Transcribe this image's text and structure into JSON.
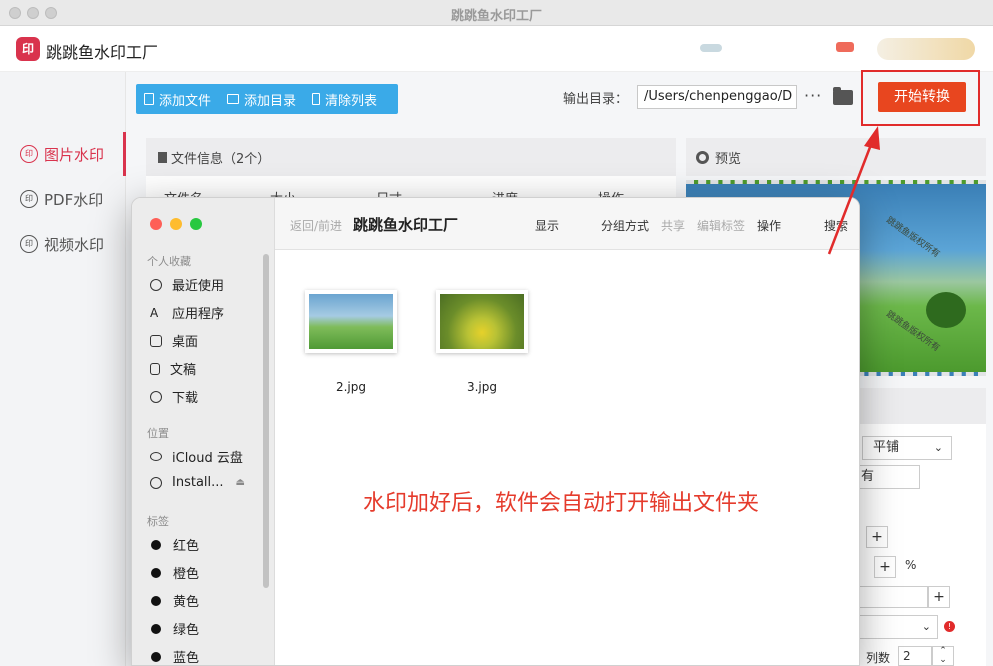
{
  "window": {
    "title": "跳跳鱼水印工厂"
  },
  "app": {
    "name": "跳跳鱼水印工厂",
    "logo_text": "印"
  },
  "nav": {
    "items": [
      {
        "label": "图片水印",
        "active": true
      },
      {
        "label": "PDF水印",
        "active": false
      },
      {
        "label": "视频水印",
        "active": false
      }
    ]
  },
  "toolbar": {
    "add_file": "添加文件",
    "add_dir": "添加目录",
    "clear_list": "清除列表",
    "output_label": "输出目录：",
    "output_path": "/Users/chenpenggao/D",
    "more": "···",
    "start": "开始转换"
  },
  "fileinfo": {
    "title": "文件信息（2个）",
    "columns": [
      "文件名",
      "大小",
      "尺寸",
      "进度",
      "操作"
    ]
  },
  "preview": {
    "title": "预览",
    "watermark_text": "跳跳鱼版权所有"
  },
  "settings": {
    "layout_value": "平铺",
    "text_value": "有",
    "percent": "%",
    "cols_label": "列数",
    "cols_value": "2",
    "plus": "+"
  },
  "finder": {
    "nav": "返回/前进",
    "title": "跳跳鱼水印工厂",
    "display": "显示",
    "group": "分组方式",
    "share": "共享",
    "edit_tags": "编辑标签",
    "action": "操作",
    "search": "搜索",
    "sections": {
      "favorites": "个人收藏",
      "locations": "位置",
      "tags": "标签"
    },
    "favorites": [
      "最近使用",
      "应用程序",
      "桌面",
      "文稿",
      "下载"
    ],
    "locations": [
      "iCloud 云盘",
      "Install..."
    ],
    "tags": [
      "红色",
      "橙色",
      "黄色",
      "绿色",
      "蓝色"
    ],
    "files": [
      "2.jpg",
      "3.jpg"
    ]
  },
  "annotation": {
    "text": "水印加好后，软件会自动打开输出文件夹"
  },
  "colors": {
    "accent": "#d9334d",
    "start_button": "#e8461f",
    "toolbar_blue": "#3aaae8",
    "annotation_red": "#e53b2c"
  }
}
